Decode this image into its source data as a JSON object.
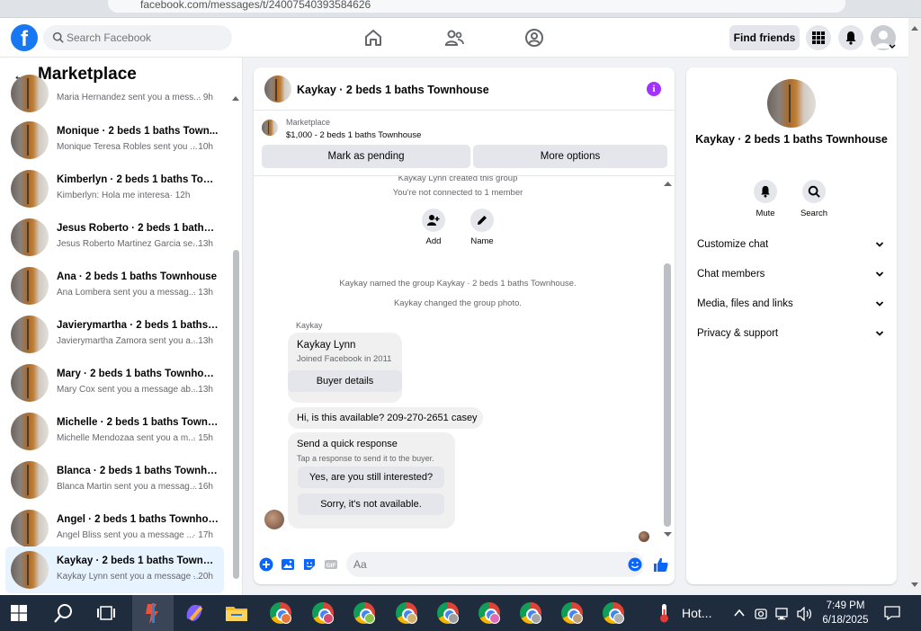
{
  "browser": {
    "url": "facebook.com/messages/t/24007540393584626"
  },
  "topnav": {
    "search_placeholder": "Search Facebook",
    "find_friends": "Find friends"
  },
  "sidebar": {
    "title": "Marketplace",
    "items": [
      {
        "name": "",
        "sub": "Maria Hernandez sent you a mess...",
        "time": "· 9h"
      },
      {
        "name": "Monique · 2 beds 1 baths Town...",
        "sub": "Monique Teresa Robles sent you ...",
        "time": "· 10h"
      },
      {
        "name": "Kimberlyn · 2 beds 1 baths Tow...",
        "sub": "Kimberlyn: Hola me interesa",
        "time": "· 12h"
      },
      {
        "name": "Jesus Roberto · 2 beds 1 baths T...",
        "sub": "Jesus Roberto Martinez Garcia se...",
        "time": "· 13h"
      },
      {
        "name": "Ana · 2 beds 1 baths Townhouse",
        "sub": "Ana Lombera sent you a messag...",
        "time": "· 13h"
      },
      {
        "name": "Javierymartha · 2 beds 1 baths T...",
        "sub": "Javierymartha Zamora sent you a...",
        "time": "· 13h"
      },
      {
        "name": "Mary · 2 beds 1 baths Townhouse",
        "sub": "Mary Cox sent you a message ab...",
        "time": "· 13h"
      },
      {
        "name": "Michelle · 2 beds 1 baths Townh...",
        "sub": "Michelle Mendozaa sent you a m...",
        "time": "· 15h"
      },
      {
        "name": "Blanca · 2 beds 1 baths Townho...",
        "sub": "Blanca Martin sent you a messag...",
        "time": "· 16h"
      },
      {
        "name": "Angel · 2 beds 1 baths Townhou...",
        "sub": "Angel Bliss sent you a message ...",
        "time": "· 17h"
      },
      {
        "name": "Kaykay · 2 beds 1 baths Townho...",
        "sub": "Kaykay Lynn sent you a message ...",
        "time": "· 20h"
      }
    ]
  },
  "chat": {
    "title": "Kaykay · 2 beds 1 baths Townhouse",
    "marketplace_label": "Marketplace",
    "listing": "$1,000 - 2 beds 1 baths Townhouse",
    "mark_pending": "Mark as pending",
    "more_options": "More options",
    "sys_created": "Kaykay Lynn created this group",
    "sys_connected": "You're not connected to 1 member",
    "action_add": "Add",
    "action_name": "Name",
    "sys_named": "Kaykay named the group Kaykay · 2 beds 1 baths Townhouse.",
    "sys_photo": "Kaykay changed the group photo.",
    "sender": "Kaykay",
    "card_name": "Kaykay Lynn",
    "card_sub": "Joined Facebook in 2011",
    "buyer_details": "Buyer details",
    "message": "Hi, is this available? 209-270-2651 casey",
    "quick_title": "Send a quick response",
    "quick_sub": "Tap a response to send it to the buyer.",
    "quick_yes": "Yes, are you still interested?",
    "quick_no": "Sorry, it's not available.",
    "composer_placeholder": "Aa"
  },
  "info": {
    "title": "Kaykay · 2 beds 1 baths Townhouse",
    "mute": "Mute",
    "search": "Search",
    "sections": [
      "Customize chat",
      "Chat members",
      "Media, files and links",
      "Privacy & support"
    ]
  },
  "taskbar": {
    "weather": "Hot...",
    "time": "7:49 PM",
    "date": "6/18/2025"
  }
}
